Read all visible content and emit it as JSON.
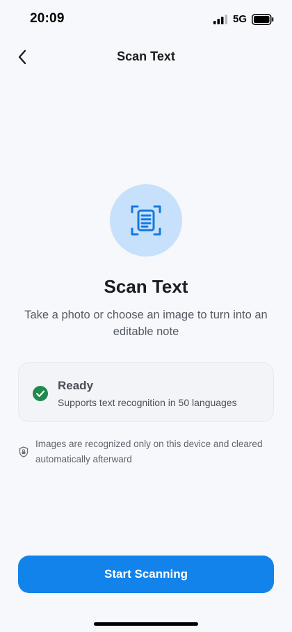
{
  "status_bar": {
    "time": "20:09",
    "network": "5G",
    "icons": [
      "signal-icon",
      "battery-icon"
    ]
  },
  "nav": {
    "title": "Scan Text",
    "back_icon": "chevron-left-icon"
  },
  "hero": {
    "icon": "document-scan-icon",
    "title": "Scan Text",
    "subtitle": "Take a photo or choose an image to turn into an editable note"
  },
  "status_card": {
    "icon": "check-circle-icon",
    "title": "Ready",
    "description": "Supports text recognition in 50 languages"
  },
  "privacy": {
    "icon": "shield-lock-icon",
    "text": "Images are recognized only on this device and cleared automatically afterward"
  },
  "primary_action": {
    "label": "Start Scanning"
  },
  "colors": {
    "background": "#f6f8fb",
    "accent": "#1183ea",
    "icon_circle": "#c7e0fb",
    "success": "#1f8a4c"
  }
}
